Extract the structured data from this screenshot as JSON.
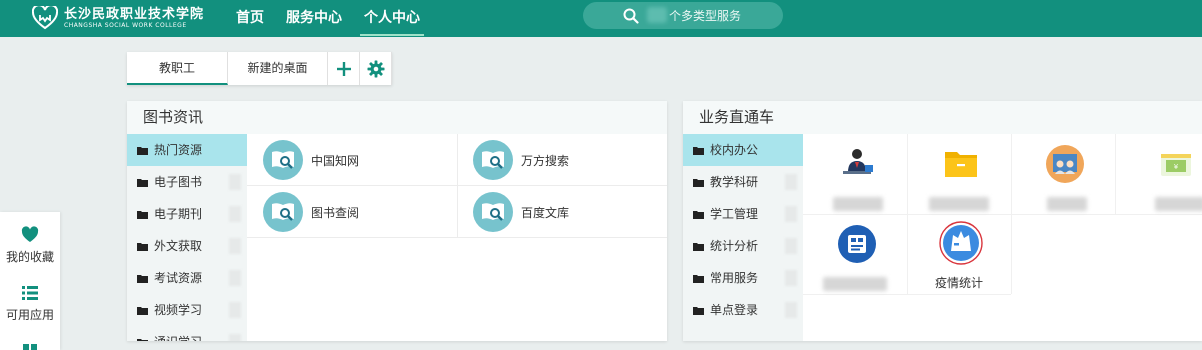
{
  "header": {
    "logo_cn": "长沙民政职业技术学院",
    "logo_en": "CHANGSHA SOCIAL WORK COLLEGE",
    "nav": [
      "首页",
      "服务中心",
      "个人中心"
    ],
    "search_placeholder": "个多类型服务"
  },
  "tabs": {
    "tab1": "教职工",
    "tab2": "新建的桌面"
  },
  "library": {
    "title": "图书资讯",
    "categories": [
      "热门资源",
      "电子图书",
      "电子期刊",
      "外文获取",
      "考试资源",
      "视频学习",
      "通识学习"
    ],
    "links": [
      "中国知网",
      "万方搜索",
      "图书查阅",
      "百度文库"
    ]
  },
  "business": {
    "title": "业务直通车",
    "categories": [
      "校内办公",
      "教学科研",
      "学工管理",
      "统计分析",
      "常用服务",
      "单点登录"
    ],
    "apps": [
      "疫情统计"
    ]
  },
  "leftbar": {
    "favorites": "我的收藏",
    "apps": "可用应用"
  },
  "colors": {
    "brand": "#12907e",
    "active_category": "#a9e4ec",
    "link_icon": "#77c3cd",
    "highlight_ring": "#d9363e"
  }
}
